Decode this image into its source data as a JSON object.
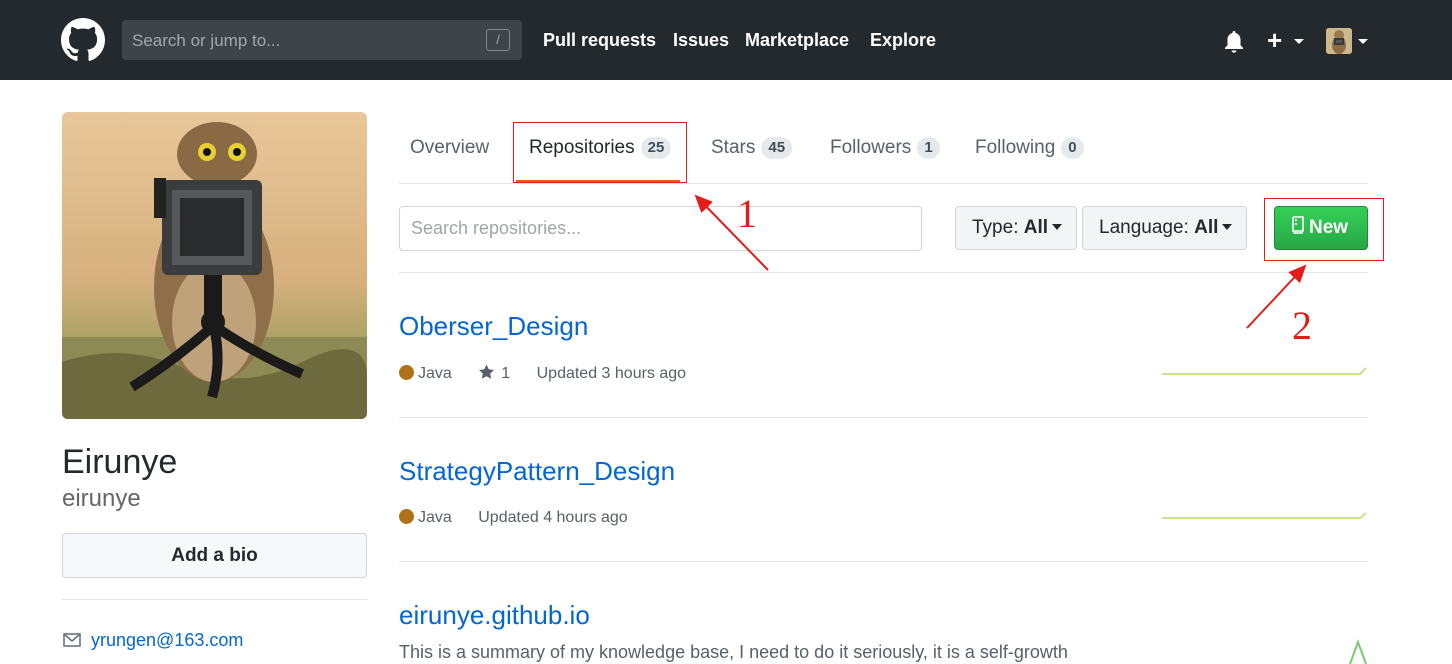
{
  "header": {
    "search_placeholder": "Search or jump to...",
    "search_shortcut": "/",
    "nav": [
      "Pull requests",
      "Issues",
      "Marketplace",
      "Explore"
    ]
  },
  "profile": {
    "fullname": "Eirunye",
    "username": "eirunye",
    "bio_button": "Add a bio",
    "email": "yrungen@163.com"
  },
  "tabs": [
    {
      "label": "Overview",
      "count": ""
    },
    {
      "label": "Repositories",
      "count": "25"
    },
    {
      "label": "Stars",
      "count": "45"
    },
    {
      "label": "Followers",
      "count": "1"
    },
    {
      "label": "Following",
      "count": "0"
    }
  ],
  "filters": {
    "search_placeholder": "Search repositories...",
    "type_label": "Type:",
    "type_value": "All",
    "language_label": "Language:",
    "language_value": "All",
    "new_button": "New"
  },
  "repos": [
    {
      "name": "Oberser_Design",
      "language": "Java",
      "stars": "1",
      "updated": "Updated 3 hours ago"
    },
    {
      "name": "StrategyPattern_Design",
      "language": "Java",
      "updated": "Updated 4 hours ago"
    },
    {
      "name": "eirunye.github.io",
      "description": "This is a summary of my knowledge base, I need to do it seriously, it is a self-growth"
    }
  ],
  "annotations": [
    "1",
    "2"
  ],
  "colors": {
    "header_bg": "#24292e",
    "link": "#0366d6",
    "java": "#b07219",
    "new_button": "#28a745",
    "tab_active_underline": "#e36209",
    "annotation_red": "#e31b1b"
  }
}
